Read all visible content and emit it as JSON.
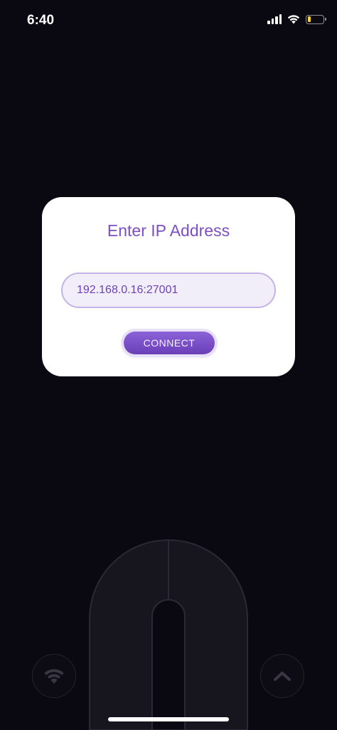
{
  "status_bar": {
    "time": "6:40",
    "icons": [
      "signal-icon",
      "wifi-icon",
      "battery-icon"
    ],
    "battery_level": 0.2,
    "battery_color": "#ffd60a"
  },
  "dialog": {
    "title": "Enter IP Address",
    "ip_value": "192.168.0.16:27001",
    "connect_label": "CONNECT"
  },
  "controls": {
    "left_button_icon": "wifi-icon",
    "right_button_icon": "chevron-up-icon"
  },
  "colors": {
    "background": "#0a0811",
    "accent": "#7c4fc4",
    "dialog_bg": "#ffffff"
  }
}
